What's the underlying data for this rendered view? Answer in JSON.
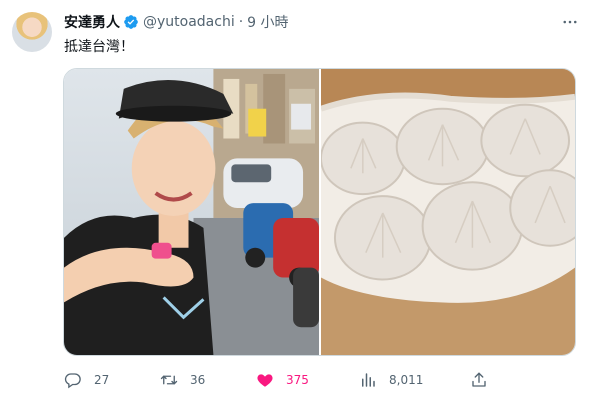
{
  "tweet": {
    "display_name": "安達勇人",
    "handle": "@yutoadachi",
    "separator": "·",
    "time": "9 小時",
    "text": "抵達台灣！"
  },
  "media": {
    "left_photo": "selfie-photo",
    "right_photo": "dumplings-photo"
  },
  "actions": {
    "replies": "27",
    "retweets": "36",
    "likes": "375",
    "views": "8,011"
  },
  "colors": {
    "verified": "#1d9bf0",
    "like_active": "#f91880",
    "secondary_text": "#536471"
  }
}
